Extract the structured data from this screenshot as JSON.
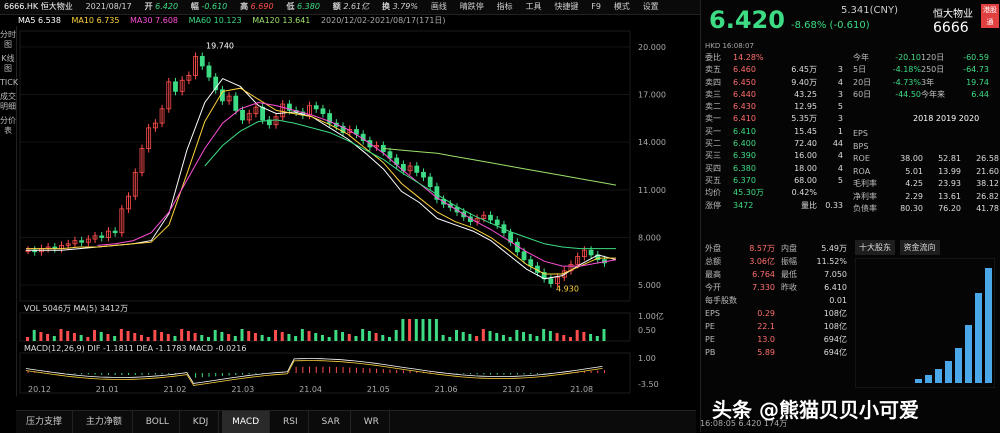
{
  "toolbar": {
    "stock": "6666.HK 恒大物业",
    "date": "2021/08/17",
    "open_label": "开",
    "open": "6.420",
    "chg_label": "幅",
    "chg": "-0.610",
    "high_label": "高",
    "high": "6.690",
    "low_label": "低",
    "low": "6.380",
    "amount_label": "额",
    "amount": "2.61亿",
    "turnover_label": "换",
    "turnover": "3.79%",
    "menu": [
      "画线",
      "晴跌停",
      "指标",
      "工具",
      "快捷键",
      "F9",
      "模式",
      "设置"
    ]
  },
  "ma": {
    "ma5": "MA5 6.538",
    "ma10": "MA10 6.735",
    "ma30": "MA30 7.608",
    "ma60": "MA60 10.123",
    "ma120": "MA120 13.641",
    "range": "2020/12/02-2021/08/17(171日)"
  },
  "sidebar": [
    "分时图",
    "K线图",
    "TICK",
    "成交明细",
    "分价表"
  ],
  "chart_data": {
    "type": "candlestick",
    "x_ticks": [
      "20.12",
      "21.01",
      "21.02",
      "21.03",
      "21.04",
      "21.05",
      "21.06",
      "21.07",
      "21.08"
    ],
    "y_ticks": [
      "20.000",
      "17.000",
      "14.000",
      "11.000",
      "8.000",
      "5.000"
    ],
    "high_label": "19.740",
    "low_label": "4.930",
    "vol_label": "VOL 5046万  MA(5) 3412万",
    "vol_ticks": [
      "1.00亿",
      "0.50"
    ],
    "macd_label": "MACD(12,26,9) DIF -1.1811 DEA -1.1783 MACD -0.0216",
    "macd_ticks": [
      "1.00",
      "-3.50"
    ],
    "closes": [
      7.2,
      7.1,
      7.3,
      7.4,
      7.3,
      7.5,
      7.6,
      7.8,
      7.7,
      7.9,
      8.1,
      8.0,
      8.4,
      8.3,
      9.8,
      10.6,
      12.1,
      13.6,
      14.9,
      15.2,
      16.1,
      17.8,
      17.2,
      17.9,
      18.2,
      19.4,
      18.8,
      18.1,
      17.3,
      16.6,
      16.9,
      16.0,
      15.4,
      15.8,
      16.2,
      15.4,
      15.1,
      15.6,
      16.4,
      16.0,
      15.9,
      15.7,
      16.3,
      16.1,
      15.8,
      15.2,
      15.0,
      14.6,
      14.8,
      14.5,
      14.1,
      13.7,
      13.8,
      13.4,
      13.0,
      12.6,
      12.2,
      12.5,
      12.1,
      11.8,
      11.2,
      10.4,
      10.1,
      9.9,
      9.6,
      9.3,
      9.0,
      9.2,
      9.4,
      9.1,
      8.8,
      8.3,
      7.7,
      7.1,
      6.6,
      6.2,
      5.8,
      5.4,
      5.1,
      5.5,
      5.9,
      6.3,
      6.8,
      7.2,
      6.9,
      6.6,
      6.4
    ],
    "ma_series": [
      {
        "name": "MA5",
        "color": "#ffffff",
        "values": [
          7.2,
          7.2,
          7.2,
          7.3,
          7.4,
          7.5,
          7.6,
          7.8,
          9.5,
          13.5,
          16.5,
          18.0,
          17.5,
          16.3,
          15.8,
          15.9,
          15.6,
          14.9,
          14.2,
          13.3,
          12.3,
          10.9,
          10.2,
          9.2,
          8.8,
          8.4,
          7.8,
          6.9,
          6.0,
          5.4,
          5.6,
          6.3,
          6.9,
          6.6
        ]
      },
      {
        "name": "MA10",
        "color": "#ffd43b",
        "values": [
          7.3,
          7.3,
          7.3,
          7.4,
          7.4,
          7.5,
          7.6,
          7.7,
          8.8,
          12.0,
          15.3,
          17.2,
          17.4,
          16.7,
          16.0,
          15.8,
          15.6,
          15.1,
          14.5,
          13.6,
          12.7,
          11.4,
          10.5,
          9.6,
          9.0,
          8.6,
          8.0,
          7.2,
          6.3,
          5.7,
          5.7,
          6.2,
          6.7,
          6.7
        ]
      },
      {
        "name": "MA30",
        "color": "#ff4fd8",
        "values": [
          null,
          null,
          null,
          null,
          7.5,
          7.6,
          7.8,
          8.3,
          9.6,
          11.6,
          13.6,
          15.2,
          16.1,
          16.5,
          16.3,
          16.0,
          15.7,
          15.3,
          14.8,
          14.1,
          13.3,
          12.3,
          11.4,
          10.5,
          9.8,
          9.1,
          8.5,
          7.8,
          7.1,
          6.5,
          6.2,
          6.2,
          6.4,
          6.6
        ]
      },
      {
        "name": "MA60",
        "color": "#3ddc84",
        "values": [
          null,
          null,
          null,
          null,
          null,
          null,
          null,
          null,
          null,
          null,
          12.5,
          13.8,
          14.7,
          15.3,
          15.4,
          15.2,
          14.9,
          14.6,
          14.1,
          13.5,
          12.9,
          12.1,
          11.4,
          10.7,
          10.0,
          9.4,
          8.9,
          8.4,
          8.0,
          7.6,
          7.4,
          7.3,
          7.3,
          7.3
        ]
      },
      {
        "name": "MA120",
        "color": "#9be16a",
        "values": [
          null,
          null,
          null,
          null,
          null,
          null,
          null,
          null,
          null,
          null,
          null,
          null,
          null,
          null,
          null,
          null,
          null,
          null,
          null,
          null,
          13.6,
          13.5,
          13.4,
          13.3,
          13.1,
          12.9,
          12.7,
          12.5,
          12.3,
          12.1,
          11.9,
          11.7,
          11.5,
          11.3
        ]
      }
    ],
    "ylim": [
      4,
      21
    ]
  },
  "bottom_tabs": [
    "压力支撑",
    "主力净额",
    "BOLL",
    "KDJ",
    "MACD",
    "RSI",
    "SAR",
    "WR"
  ],
  "quote": {
    "price": "6.420",
    "chg": "-8.68% (-0.610)",
    "prev_close": "5.341(CNY)",
    "name": "恒大物业",
    "code": "6666",
    "badge": "港股通"
  },
  "orderbook_head": "HKD 16:08:07",
  "orderbook": [
    {
      "label": "委比",
      "price": "14.28%",
      "vol": "",
      "n": ""
    },
    {
      "label": "卖五",
      "price": "6.460",
      "vol": "6.45万",
      "n": "3"
    },
    {
      "label": "卖四",
      "price": "6.450",
      "vol": "9.40万",
      "n": "4"
    },
    {
      "label": "卖三",
      "price": "6.440",
      "vol": "43.25",
      "n": "3"
    },
    {
      "label": "卖二",
      "price": "6.430",
      "vol": "12.95",
      "n": "5"
    },
    {
      "label": "卖一",
      "price": "6.410",
      "vol": "5.35万",
      "n": "3"
    },
    {
      "label": "买一",
      "price": "6.410",
      "vol": "15.45",
      "n": "1"
    },
    {
      "label": "买二",
      "price": "6.400",
      "vol": "72.40",
      "n": "44"
    },
    {
      "label": "买三",
      "price": "6.390",
      "vol": "16.00",
      "n": "4"
    },
    {
      "label": "买四",
      "price": "6.380",
      "vol": "18.00",
      "n": "4"
    },
    {
      "label": "买五",
      "price": "6.370",
      "vol": "68.00",
      "n": "5"
    },
    {
      "label": "均价",
      "price": "45.30万",
      "vol": "0.42%",
      "n": ""
    },
    {
      "label": "涨停",
      "price": "3472",
      "vol": "量比",
      "n": "0.33"
    }
  ],
  "stats": [
    {
      "l": "今年",
      "a": "-20.10",
      "b": "120日",
      "c": "-60.59"
    },
    {
      "l": "5日",
      "a": "-4.18%",
      "b": "250日",
      "c": "-64.73"
    },
    {
      "l": "20日",
      "a": "-4.73%",
      "b": "3年",
      "c": "19.74"
    },
    {
      "l": "60日",
      "a": "-44.50",
      "b": "今年来",
      "c": "6.44"
    }
  ],
  "fin_years": "2018  2019  2020",
  "fin": [
    {
      "l": "EPS",
      "a": "",
      "b": "",
      "c": ""
    },
    {
      "l": "BPS",
      "a": "",
      "b": "",
      "c": ""
    },
    {
      "l": "ROE",
      "a": "38.00",
      "b": "52.81",
      "c": "26.58"
    },
    {
      "l": "ROA",
      "a": "5.01",
      "b": "13.99",
      "c": "21.60"
    },
    {
      "l": "毛利率",
      "a": "4.25",
      "b": "23.93",
      "c": "38.12"
    },
    {
      "l": "净利率",
      "a": "2.29",
      "b": "13.61",
      "c": "26.82"
    },
    {
      "l": "负债率",
      "a": "80.30",
      "b": "76.20",
      "c": "41.78"
    }
  ],
  "panel_tabs": [
    "十大股东",
    "资金流向"
  ],
  "detail": [
    {
      "l": "外盘",
      "v": "8.57万",
      "l2": "内盘",
      "v2": "5.49万"
    },
    {
      "l": "总额",
      "v": "3.06亿",
      "l2": "振幅",
      "v2": "11.52%"
    },
    {
      "l": "最高",
      "v": "6.764",
      "l2": "最低",
      "v2": "7.050"
    },
    {
      "l": "今开",
      "v": "7.330",
      "l2": "昨收",
      "v2": "6.410"
    },
    {
      "l": "每手股数",
      "v": "",
      "l2": "",
      "v2": "0.01"
    },
    {
      "l": "EPS",
      "v": "0.29",
      "l2": "",
      "v2": "108亿"
    },
    {
      "l": "PE",
      "v": "22.1",
      "l2": "",
      "v2": "108亿"
    },
    {
      "l": "PE",
      "v": "13.0",
      "l2": "",
      "v2": "694亿"
    },
    {
      "l": "PB",
      "v": "5.89",
      "l2": "",
      "v2": "694亿"
    }
  ],
  "colors": {
    "up": "#ff4d4d",
    "down": "#3ddc84"
  },
  "watermark": "头条 @熊猫贝贝小可爱",
  "timeline": "16:08:05  6.420  174万"
}
